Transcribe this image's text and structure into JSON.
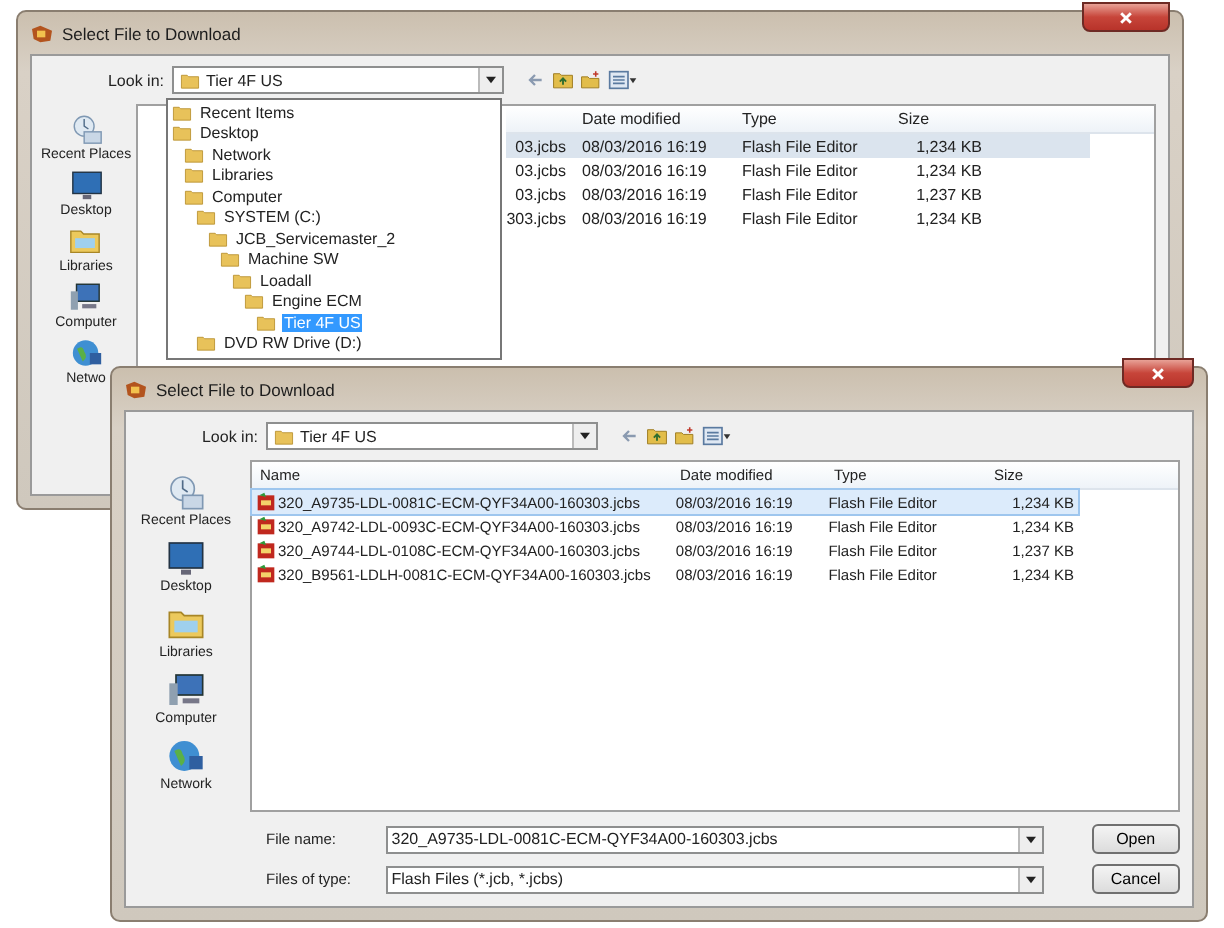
{
  "back_window": {
    "title": "Select File to Download",
    "look_in": {
      "label": "Look in:",
      "value": "Tier 4F US"
    },
    "places": [
      "Recent Places",
      "Desktop",
      "Libraries",
      "Computer",
      "Netwo"
    ],
    "columns": [
      "Date modified",
      "Type",
      "Size"
    ],
    "rows": [
      {
        "name": "03.jcbs",
        "date": "08/03/2016 16:19",
        "type": "Flash File Editor",
        "size": "1,234 KB",
        "selected": true
      },
      {
        "name": "03.jcbs",
        "date": "08/03/2016 16:19",
        "type": "Flash File Editor",
        "size": "1,234 KB",
        "selected": false
      },
      {
        "name": "03.jcbs",
        "date": "08/03/2016 16:19",
        "type": "Flash File Editor",
        "size": "1,237 KB",
        "selected": false
      },
      {
        "name": "303.jcbs",
        "date": "08/03/2016 16:19",
        "type": "Flash File Editor",
        "size": "1,234 KB",
        "selected": false
      }
    ],
    "look_in_list": [
      {
        "label": "Recent Items",
        "selected": false
      },
      {
        "label": "Desktop",
        "selected": false,
        "children": [
          {
            "label": "Network",
            "selected": false
          },
          {
            "label": "Libraries",
            "selected": false
          },
          {
            "label": "Computer",
            "selected": false,
            "children": [
              {
                "label": "SYSTEM (C:)",
                "selected": false,
                "children": [
                  {
                    "label": "JCB_Servicemaster_2",
                    "selected": false,
                    "children": [
                      {
                        "label": "Machine SW",
                        "selected": false,
                        "children": [
                          {
                            "label": "Loadall",
                            "selected": false,
                            "children": [
                              {
                                "label": "Engine ECM",
                                "selected": false,
                                "children": [
                                  {
                                    "label": "Tier 4F US",
                                    "selected": true
                                  }
                                ]
                              }
                            ]
                          }
                        ]
                      }
                    ]
                  }
                ]
              },
              {
                "label": "DVD RW Drive (D:)",
                "selected": false
              }
            ]
          }
        ]
      }
    ]
  },
  "front_window": {
    "title": "Select File to Download",
    "look_in": {
      "label": "Look in:",
      "value": "Tier 4F US"
    },
    "places": [
      "Recent Places",
      "Desktop",
      "Libraries",
      "Computer",
      "Network"
    ],
    "columns": [
      "Name",
      "Date modified",
      "Type",
      "Size"
    ],
    "rows": [
      {
        "name": "320_A9735-LDL-0081C-ECM-QYF34A00-160303.jcbs",
        "date": "08/03/2016 16:19",
        "type": "Flash File Editor",
        "size": "1,234 KB",
        "selected": true
      },
      {
        "name": "320_A9742-LDL-0093C-ECM-QYF34A00-160303.jcbs",
        "date": "08/03/2016 16:19",
        "type": "Flash File Editor",
        "size": "1,234 KB",
        "selected": false
      },
      {
        "name": "320_A9744-LDL-0108C-ECM-QYF34A00-160303.jcbs",
        "date": "08/03/2016 16:19",
        "type": "Flash File Editor",
        "size": "1,237 KB",
        "selected": false
      },
      {
        "name": "320_B9561-LDLH-0081C-ECM-QYF34A00-160303.jcbs",
        "date": "08/03/2016 16:19",
        "type": "Flash File Editor",
        "size": "1,234 KB",
        "selected": false
      }
    ],
    "file_name": {
      "label": "File name:",
      "value": "320_A9735-LDL-0081C-ECM-QYF34A00-160303.jcbs"
    },
    "files_of_type": {
      "label": "Files of type:",
      "value": "Flash Files (*.jcb, *.jcbs)"
    },
    "buttons": [
      "Open",
      "Cancel"
    ]
  }
}
